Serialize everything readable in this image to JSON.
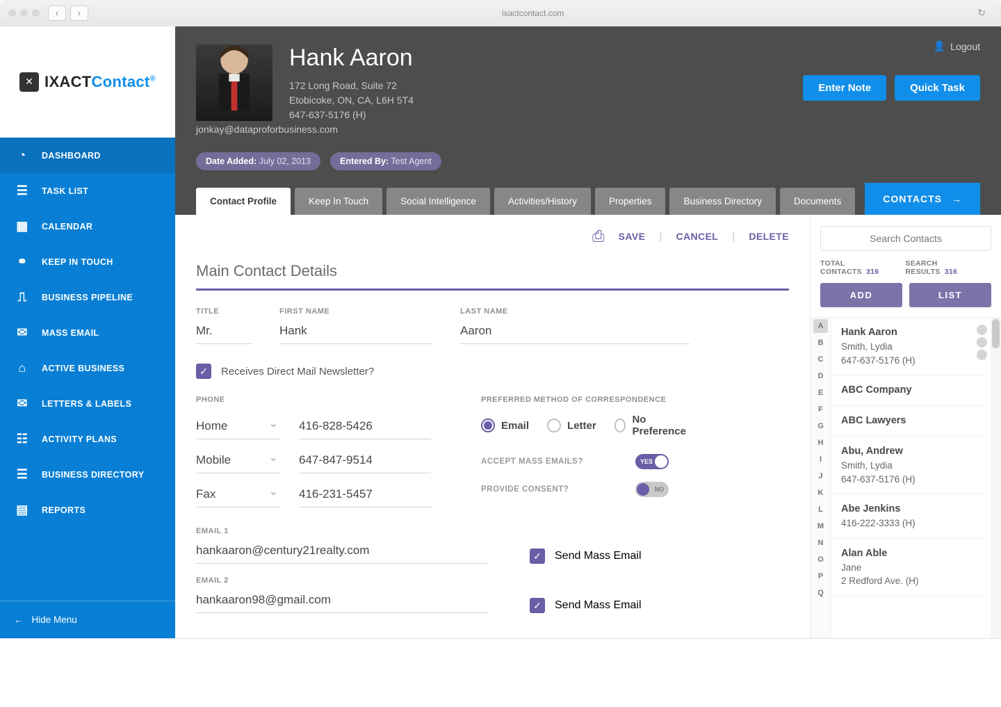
{
  "browser": {
    "url": "ixactcontact.com"
  },
  "brand": {
    "name1": "IXACT",
    "name2": "Contact"
  },
  "logout": "Logout",
  "sidebar": {
    "items": [
      {
        "label": "DASHBOARD",
        "icon": "◔"
      },
      {
        "label": "TASK LIST",
        "icon": "☰"
      },
      {
        "label": "CALENDAR",
        "icon": "▦"
      },
      {
        "label": "KEEP IN TOUCH",
        "icon": "⚭"
      },
      {
        "label": "BUSINESS PIPELINE",
        "icon": "⎍"
      },
      {
        "label": "MASS EMAIL",
        "icon": "✉"
      },
      {
        "label": "ACTIVE  BUSINESS",
        "icon": "⌂"
      },
      {
        "label": "LETTERS & LABELS",
        "icon": "✉"
      },
      {
        "label": "ACTIVITY PLANS",
        "icon": "☷"
      },
      {
        "label": "BUSINESS DIRECTORY",
        "icon": "☰"
      },
      {
        "label": "REPORTS",
        "icon": "▤"
      }
    ],
    "hide": "Hide Menu"
  },
  "header": {
    "name": "Hank Aaron",
    "addr1": "172 Long Road, Suite 72",
    "addr2": "Etobicoke, ON, CA, L6H 5T4",
    "phone": "647-637-5176 (H)",
    "email": "jonkay@dataproforbusiness.com",
    "date_added_label": "Date Added:",
    "date_added": "July 02, 2013",
    "entered_by_label": "Entered By:",
    "entered_by": "Test Agent",
    "enter_note": "Enter Note",
    "quick_task": "Quick Task"
  },
  "tabs": [
    "Contact Profile",
    "Keep In Touch",
    "Social Intelligence",
    "Activities/History",
    "Properties",
    "Business Directory",
    "Documents"
  ],
  "contacts_btn": "CONTACTS",
  "actions": {
    "save": "SAVE",
    "cancel": "CANCEL",
    "delete": "DELETE"
  },
  "section": "Main Contact Details",
  "form": {
    "title_label": "TITLE",
    "title": "Mr.",
    "first_label": "FIRST NAME",
    "first": "Hank",
    "last_label": "LAST NAME",
    "last": "Aaron",
    "newsletter": "Receives Direct Mail Newsletter?",
    "phone_label": "PHONE",
    "phones": [
      {
        "type": "Home",
        "number": "416-828-5426"
      },
      {
        "type": "Mobile",
        "number": "647-847-9514"
      },
      {
        "type": "Fax",
        "number": "416-231-5457"
      }
    ],
    "pref_label": "PREFERRED METHOD OF CORRESPONDENCE",
    "pref_options": [
      "Email",
      "Letter",
      "No Preference"
    ],
    "accept_mass": "ACCEPT MASS EMAILS?",
    "consent": "PROVIDE CONSENT?",
    "yes": "YES",
    "no": "NO",
    "email1_label": "EMAIL 1",
    "email1": "hankaaron@century21realty.com",
    "email2_label": "EMAIL 2",
    "email2": "hankaaron98@gmail.com",
    "send_mass": "Send Mass Email"
  },
  "side": {
    "search_placeholder": "Search Contacts",
    "total_label": "TOTAL CONTACTS",
    "total": "316",
    "results_label": "SEARCH RESULTS",
    "results": "316",
    "add": "ADD",
    "list": "LIST",
    "alpha": [
      "A",
      "B",
      "C",
      "D",
      "E",
      "F",
      "G",
      "H",
      "I",
      "J",
      "K",
      "L",
      "M",
      "N",
      "O",
      "P",
      "Q"
    ],
    "contacts": [
      {
        "name": "Hank Aaron",
        "line2": "Smith, Lydia",
        "line3": "647-637-5176 (H)",
        "badges": true
      },
      {
        "name": "ABC Company"
      },
      {
        "name": "ABC Lawyers"
      },
      {
        "name": "Abu, Andrew",
        "line2": "Smith, Lydia",
        "line3": "647-637-5176 (H)"
      },
      {
        "name": "Abe Jenkins",
        "line2": "416-222-3333 (H)"
      },
      {
        "name": "Alan Able",
        "line2": "Jane",
        "line3": "2 Redford Ave. (H)"
      }
    ]
  }
}
